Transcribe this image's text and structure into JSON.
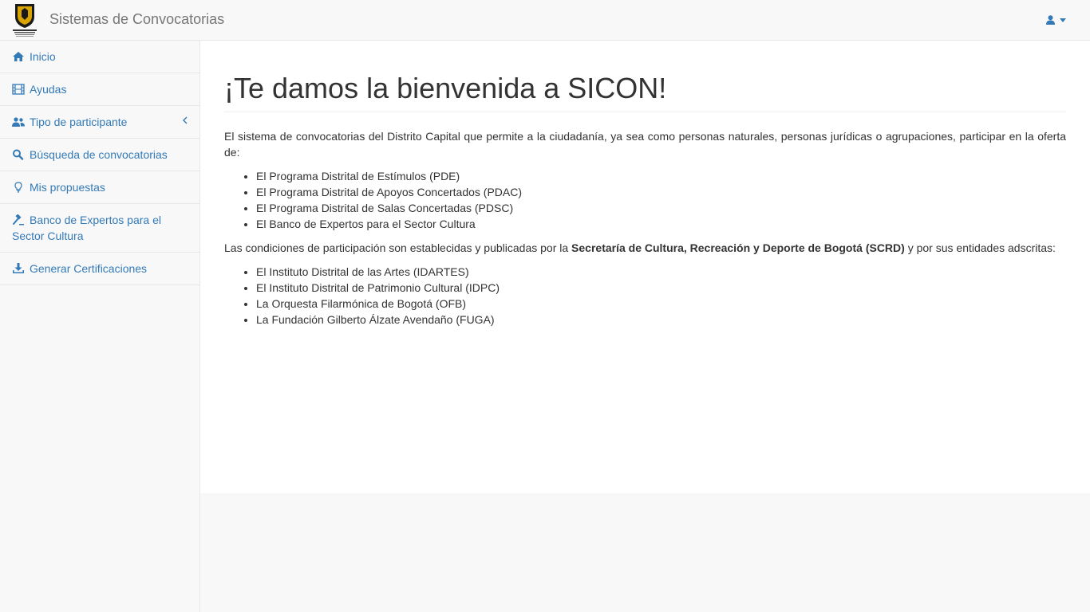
{
  "header": {
    "brand": "Sistemas de Convocatorias",
    "logo_label": "ALCALDÍA MAYOR DE BOGOTÁ D.C.",
    "user_menu_icon": "user-icon"
  },
  "sidebar": {
    "items": [
      {
        "label": "Inicio",
        "icon": "home-icon"
      },
      {
        "label": "Ayudas",
        "icon": "film-icon"
      },
      {
        "label": "Tipo de participante",
        "icon": "users-icon",
        "expandable": true
      },
      {
        "label": "Búsqueda de convocatorias",
        "icon": "search-icon"
      },
      {
        "label": "Mis propuestas",
        "icon": "lightbulb-icon"
      },
      {
        "label": "Banco de Expertos para el Sector Cultura",
        "icon": "gavel-icon"
      },
      {
        "label": "Generar Certificaciones",
        "icon": "download-icon"
      }
    ]
  },
  "main": {
    "title": "¡Te damos la bienvenida a SICON!",
    "intro": "El sistema de convocatorias del Distrito Capital que permite a la ciudadanía, ya sea como personas naturales, personas jurídicas o agrupaciones, participar en la oferta de:",
    "programs": [
      "El Programa Distrital de Estímulos (PDE)",
      "El Programa Distrital de Apoyos Concertados (PDAC)",
      "El Programa Distrital de Salas Concertadas (PDSC)",
      "El Banco de Expertos para el Sector Cultura"
    ],
    "conditions_prefix": "Las condiciones de participación son establecidas y publicadas por la ",
    "conditions_entity": "Secretaría de Cultura, Recreación y Deporte de Bogotá (SCRD)",
    "conditions_suffix": " y por sus entidades adscritas:",
    "entities": [
      "El Instituto Distrital de las Artes (IDARTES)",
      "El Instituto Distrital de Patrimonio Cultural (IDPC)",
      "La Orquesta Filarmónica de Bogotá (OFB)",
      "La Fundación Gilberto Álzate Avendaño (FUGA)"
    ]
  },
  "colors": {
    "link": "#337ab7",
    "brand_text": "#777777",
    "border": "#e7e7e7"
  }
}
